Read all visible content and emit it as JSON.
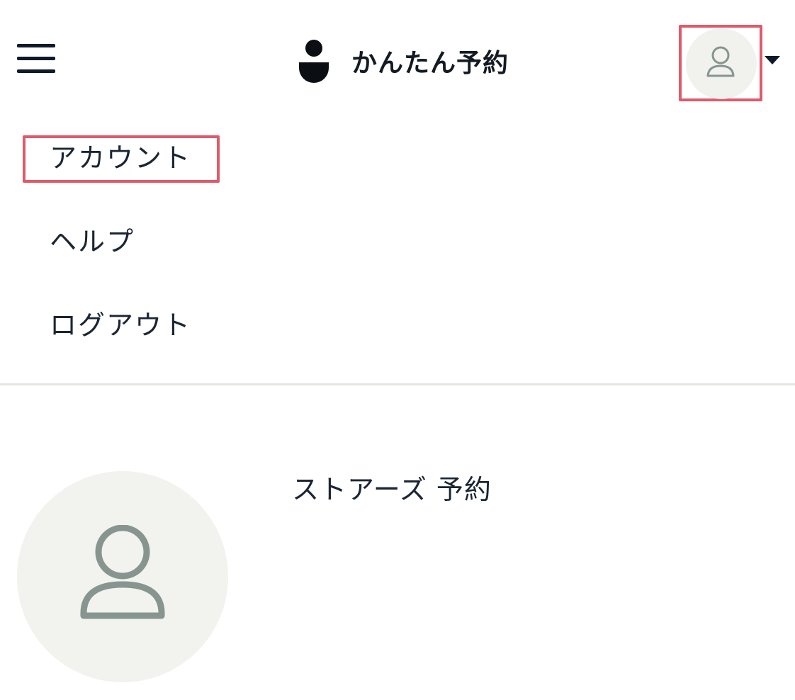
{
  "header": {
    "brand_name": "かんたん予約",
    "menu_icon": "hamburger-menu-icon",
    "logo_icon": "person-logo-icon",
    "account_icon": "user-icon",
    "dropdown_icon": "caret-down-icon"
  },
  "menu": {
    "items": [
      {
        "label": "アカウント"
      },
      {
        "label": "ヘルプ"
      },
      {
        "label": "ログアウト"
      }
    ]
  },
  "profile": {
    "store_name": "ストアーズ 予約",
    "avatar_icon": "user-icon"
  },
  "colors": {
    "highlight": "#e05a6a",
    "avatar_bg": "#f1f1ed",
    "icon_stroke": "#869590",
    "text": "#1b2533"
  }
}
